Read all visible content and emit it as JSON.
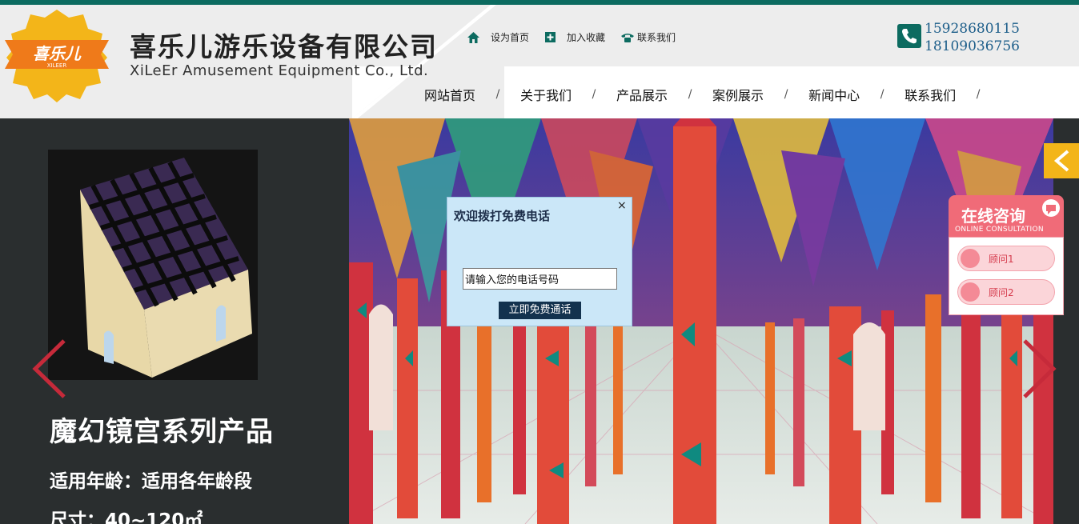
{
  "header": {
    "logo_text": "喜乐儿",
    "logo_sub": "XILEER",
    "company_cn": "喜乐儿游乐设备有限公司",
    "company_en": "XiLeEr Amusement Equipment Co., Ltd.",
    "quick_links": [
      {
        "label": "设为首页",
        "icon": "home-icon"
      },
      {
        "label": "加入收藏",
        "icon": "bookmark-plus-icon"
      },
      {
        "label": "联系我们",
        "icon": "telephone-icon"
      }
    ],
    "phones": [
      "15928680115",
      "18109036756"
    ]
  },
  "nav": {
    "items": [
      "网站首页",
      "关于我们",
      "产品展示",
      "案例展示",
      "新闻中心",
      "联系我们"
    ],
    "separator": "/"
  },
  "hero": {
    "product_title": "魔幻镜宫系列产品",
    "age_line": "适用年龄：适用各年龄段",
    "size_line": "尺寸：40~120㎡"
  },
  "consult": {
    "title": "在线咨询",
    "subtitle": "ONLINE CONSULTATION",
    "agents": [
      "顾问1",
      "顾问2"
    ]
  },
  "popup": {
    "title": "欢迎拨打免费电话",
    "close": "×",
    "input_value": "请输入您的电话号码",
    "submit": "立即免费通话"
  },
  "colors": {
    "brand_green": "#0c6b60",
    "accent_yellow": "#f3b519",
    "consult_pink": "#f06b78",
    "popup_bg": "#cbe7f8"
  }
}
